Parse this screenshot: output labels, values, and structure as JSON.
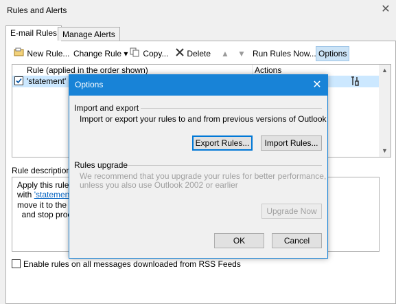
{
  "window": {
    "title": "Rules and Alerts",
    "close_glyph": "✕"
  },
  "tabs": [
    {
      "label": "E-mail Rules"
    },
    {
      "label": "Manage Alerts"
    }
  ],
  "toolbar": {
    "new_rule": "New Rule...",
    "change_rule": "Change Rule",
    "copy": "Copy...",
    "delete": "Delete",
    "run_rules": "Run Rules Now...",
    "options": "Options",
    "dropdown_glyph": "▾"
  },
  "rules_list": {
    "columns": {
      "rule": "Rule (applied in the order shown)",
      "actions": "Actions"
    },
    "rows": [
      {
        "name": "'statement' c",
        "checked": true
      }
    ]
  },
  "description": {
    "label": "Rule description",
    "lines": [
      {
        "text": "Apply this rule"
      },
      {
        "prefix": "with ",
        "link": "'statemen"
      },
      {
        "prefix": "move it to the ",
        "link": ""
      },
      {
        "text": "  and stop proc"
      }
    ]
  },
  "rss": {
    "label": "Enable rules on all messages downloaded from RSS Feeds"
  },
  "dialog": {
    "title": "Options",
    "close_glyph": "✕",
    "import_export": {
      "title": "Import and export",
      "text": "Import or export your rules to and from previous versions of Outlook",
      "export_button": "Export Rules...",
      "import_button": "Import Rules..."
    },
    "upgrade": {
      "title": "Rules upgrade",
      "text_line1": "We recommend that you upgrade your rules for better performance,",
      "text_line2": "unless you also use Outlook 2002 or earlier",
      "upgrade_button": "Upgrade Now"
    },
    "ok": "OK",
    "cancel": "Cancel"
  },
  "colors": {
    "accent": "#1883d7",
    "selection": "#cce8ff",
    "link": "#0563c1"
  }
}
